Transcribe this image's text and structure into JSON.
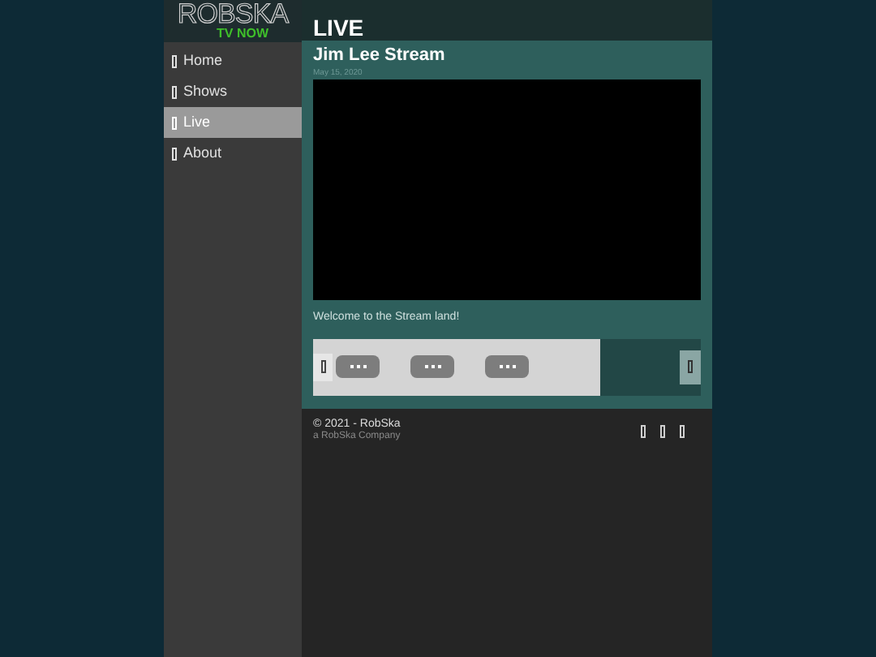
{
  "logo": {
    "title": "ROBSKA",
    "subtitle": "TV NOW"
  },
  "nav": [
    {
      "label": "Home",
      "selected": false
    },
    {
      "label": "Shows",
      "selected": false
    },
    {
      "label": "Live",
      "selected": true
    },
    {
      "label": "About",
      "selected": false
    }
  ],
  "page_title": "LIVE",
  "stream": {
    "title": "Jim Lee Stream",
    "date": "May 15, 2020",
    "description": "Welcome to the Stream land!"
  },
  "carousel": {
    "items": [
      {
        "kind": "more"
      },
      {
        "kind": "more"
      },
      {
        "kind": "more"
      }
    ],
    "level": 0.74
  },
  "footer": {
    "copyright": "© 2021 - RobSka",
    "company": "a RobSka Company",
    "links": [
      {
        "kind": "icon"
      },
      {
        "kind": "icon"
      },
      {
        "kind": "icon"
      }
    ]
  }
}
